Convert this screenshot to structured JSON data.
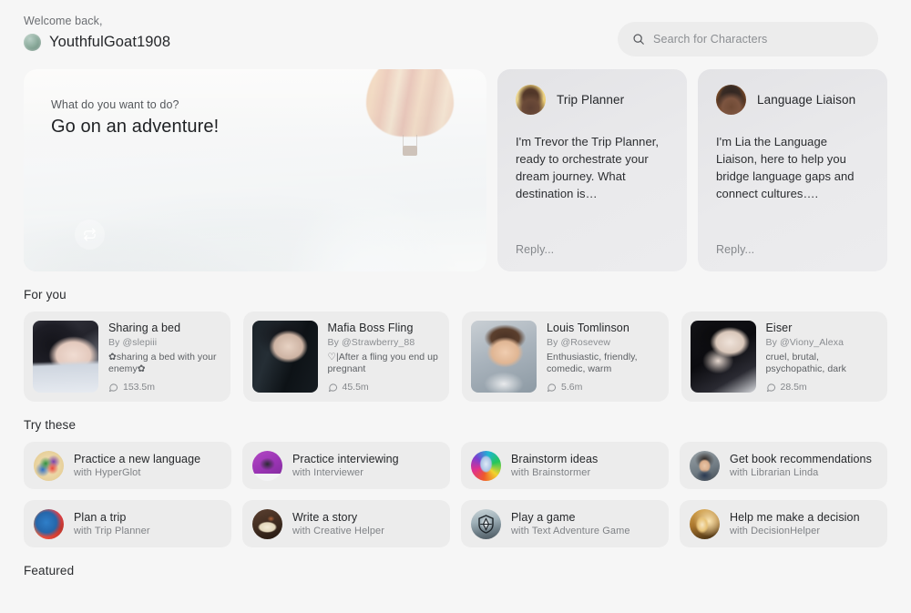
{
  "header": {
    "greeting": "Welcome back,",
    "username": "YouthfulGoat1908",
    "search": {
      "placeholder": "Search for Characters",
      "icon": "search-icon"
    }
  },
  "hero": {
    "kicker": "What do you want to do?",
    "title": "Go on an adventure!",
    "refresh_icon": "refresh-icon"
  },
  "personas": [
    {
      "name": "Trip Planner",
      "message": "I'm Trevor the Trip Planner, ready to orchestrate your dream journey. What destination is…",
      "reply_placeholder": "Reply...",
      "avatar": "trip-planner-avatar"
    },
    {
      "name": "Language Liaison",
      "message": "I'm Lia the Language Liaison, here to help you bridge language gaps and connect cultures….",
      "reply_placeholder": "Reply...",
      "avatar": "language-liaison-avatar"
    }
  ],
  "for_you": {
    "title": "For you",
    "cards": [
      {
        "name": "Sharing a bed",
        "author": "By @slepiii",
        "description": "✿sharing a bed with your enemy✿",
        "chats": "153.5m",
        "thumb": "sharing-a-bed-thumbnail"
      },
      {
        "name": "Mafia Boss Fling",
        "author": "By @Strawberry_88",
        "description": "♡|After a fling you end up pregnant",
        "chats": "45.5m",
        "thumb": "mafia-boss-fling-thumbnail"
      },
      {
        "name": "Louis Tomlinson",
        "author": "By @Rosevew",
        "description": "Enthusiastic, friendly, comedic, warm",
        "chats": "5.6m",
        "thumb": "louis-tomlinson-thumbnail"
      },
      {
        "name": "Eiser",
        "author": "By @Viony_Alexa",
        "description": "cruel, brutal, psychopathic, dark romance",
        "chats": "28.5m",
        "thumb": "eiser-thumbnail"
      }
    ]
  },
  "try_these": {
    "title": "Try these",
    "tiles": [
      {
        "title": "Practice a new language",
        "subtitle": "with HyperGlot",
        "icon": "globe-languages-icon"
      },
      {
        "title": "Practice interviewing",
        "subtitle": "with Interviewer",
        "icon": "interviewer-icon"
      },
      {
        "title": "Brainstorm ideas",
        "subtitle": "with Brainstormer",
        "icon": "lightbulb-icon"
      },
      {
        "title": "Get book recommendations",
        "subtitle": "with Librarian Linda",
        "icon": "librarian-icon"
      },
      {
        "title": "Plan a trip",
        "subtitle": "with Trip Planner",
        "icon": "globe-trip-icon"
      },
      {
        "title": "Write a story",
        "subtitle": "with Creative Helper",
        "icon": "open-book-icon"
      },
      {
        "title": "Play a game",
        "subtitle": "with Text Adventure Game",
        "icon": "shield-compass-icon"
      },
      {
        "title": "Help me make a decision",
        "subtitle": "with DecisionHelper",
        "icon": "decision-face-icon"
      }
    ]
  },
  "featured": {
    "title": "Featured"
  },
  "colors": {
    "page_background": "#f6f6f6",
    "card_background": "#ececec",
    "text_primary": "#25272a",
    "text_muted": "#8a8d91"
  }
}
